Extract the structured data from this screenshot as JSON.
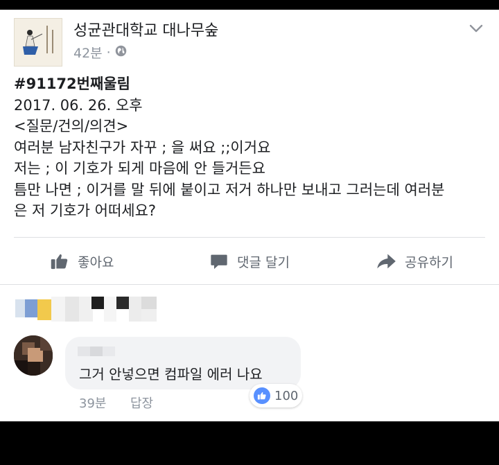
{
  "post": {
    "page_name": "성균관대학교 대나무숲",
    "time": "42분",
    "dot": "·",
    "privacy_icon": "globe-icon",
    "menu_icon": "chevron-down-icon",
    "lines": [
      "#91172번째울림",
      "2017. 06. 26. 오후",
      "<질문/건의/의견>",
      "여러분 남자친구가 자꾸 ; 을 써요 ;;이거요",
      "저는 ; 이 기호가 되게 마음에 안 들거든요",
      "틈만 나면 ; 이거를 말 뒤에 붙이고 저거 하나만 보내고 그러는데 여러분",
      "은 저 기호가 어떠세요?"
    ]
  },
  "actions": {
    "like_label": "좋아요",
    "comment_label": "댓글 달기",
    "share_label": "공유하기",
    "like_icon": "thumbs-up-icon",
    "comment_icon": "comment-icon",
    "share_icon": "share-arrow-icon"
  },
  "comment": {
    "text": "그거 안넣으면 컴파일 에러 나요",
    "time": "39분",
    "reply_label": "답장",
    "likes": "100"
  },
  "colors": {
    "text_primary": "#1c1e21",
    "text_secondary": "#606770",
    "meta": "#8d949e",
    "like_blue": "#5890ff",
    "bubble": "#f2f3f5"
  }
}
